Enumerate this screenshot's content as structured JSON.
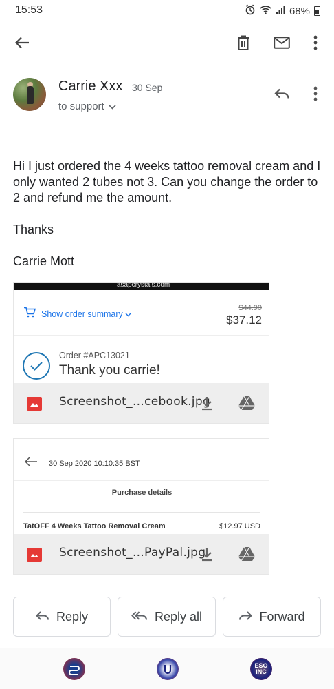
{
  "status": {
    "time": "15:53",
    "battery": "68%"
  },
  "email": {
    "sender_name": "Carrie Xxx",
    "date": "30 Sep",
    "recipient": "to support",
    "body": [
      "Hi I just ordered the 4 weeks tattoo removal cream and I only wanted 2 tubes not 3. Can you change the order to 2 and refund me the amount.",
      "Thanks",
      "Carrie Mott"
    ]
  },
  "attachments": [
    {
      "filename": "Screenshot_...cebook.jpg",
      "preview": {
        "url": "asapcrystals.com",
        "summary_link": "Show order summary",
        "old_price": "$44.90",
        "new_price": "$37.12",
        "order_number": "Order #APC13021",
        "thank_you": "Thank you carrie!"
      }
    },
    {
      "filename": "Screenshot_...PayPal.jpg",
      "preview": {
        "date": "30 Sep 2020 10:10:35 BST",
        "heading": "Purchase details",
        "item": "TatOFF 4 Weeks Tattoo Removal Cream",
        "amount": "$12.97 USD"
      }
    }
  ],
  "actions": {
    "reply": "Reply",
    "reply_all": "Reply all",
    "forward": "Forward"
  },
  "dock": {
    "app3_label": "ESO INC"
  },
  "colors": {
    "link_blue": "#1a73e8",
    "attachment_image_red": "#e53935"
  }
}
